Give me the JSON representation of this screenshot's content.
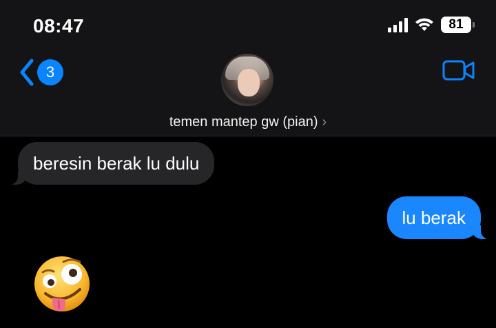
{
  "status": {
    "time": "08:47",
    "battery": "81"
  },
  "nav": {
    "back_count": "3",
    "contact_name": "temen mantep gw (pian)",
    "back_icon": "chevron-left-icon",
    "video_icon": "video-camera-icon"
  },
  "messages": [
    {
      "direction": "incoming",
      "text": "beresin berak lu dulu"
    },
    {
      "direction": "outgoing",
      "text": "lu berak"
    },
    {
      "direction": "incoming",
      "type": "emoji",
      "icon": "zany-face-emoji"
    }
  ],
  "colors": {
    "accent": "#0a84ff",
    "outgoing_bubble": "#1a86ff",
    "incoming_bubble": "#262628",
    "header_bg": "#141416",
    "background": "#000000"
  }
}
